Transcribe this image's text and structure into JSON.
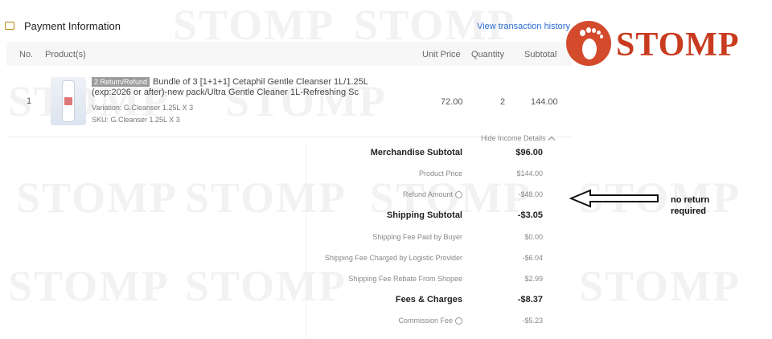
{
  "watermark": "STOMP",
  "header": {
    "icon": "wallet-icon",
    "title": "Payment Information",
    "history_link": "View transaction history"
  },
  "table": {
    "columns": {
      "no": "No.",
      "product": "Product(s)",
      "unit_price": "Unit Price",
      "quantity": "Quantity",
      "subtotal": "Subtotal"
    },
    "row": {
      "no": "1",
      "badge": "2 Return/Refund",
      "name": "Bundle of 3 [1+1+1] Cetaphil Gentle Cleanser 1L/1.25L (exp:2026 or after)-new pack/Ultra Gentle Cleaner 1L-Refreshing Sc",
      "variation": "Variation: G.Cleanser 1.25L X 3",
      "sku": "SKU: G.Cleanser 1.25L X 3",
      "unit_price": "72.00",
      "quantity": "2",
      "subtotal": "144.00"
    }
  },
  "income": {
    "toggle_label": "Hide Income Details",
    "rows": [
      {
        "label": "Merchandise Subtotal",
        "value": "$96.00",
        "style": "bold"
      },
      {
        "label": "Product Price",
        "value": "$144.00",
        "style": "sub"
      },
      {
        "label": "Refund Amount",
        "value": "-$48.00",
        "style": "sub",
        "help": true
      },
      {
        "label": "Shipping Subtotal",
        "value": "-$3.05",
        "style": "bold"
      },
      {
        "label": "Shipping Fee Paid by Buyer",
        "value": "$0.00",
        "style": "sub"
      },
      {
        "label": "Shipping Fee Charged by Logistic Provider",
        "value": "-$6.04",
        "style": "sub"
      },
      {
        "label": "Shipping Fee Rebate From Shopee",
        "value": "$2.99",
        "style": "sub"
      },
      {
        "label": "Fees & Charges",
        "value": "-$8.37",
        "style": "bold"
      },
      {
        "label": "Commission Fee",
        "value": "-$5.23",
        "style": "sub",
        "help": true
      }
    ]
  },
  "logo": {
    "text": "STOMP",
    "color": "#d34a2c"
  },
  "annotation": {
    "text": "no return\nrequired"
  }
}
